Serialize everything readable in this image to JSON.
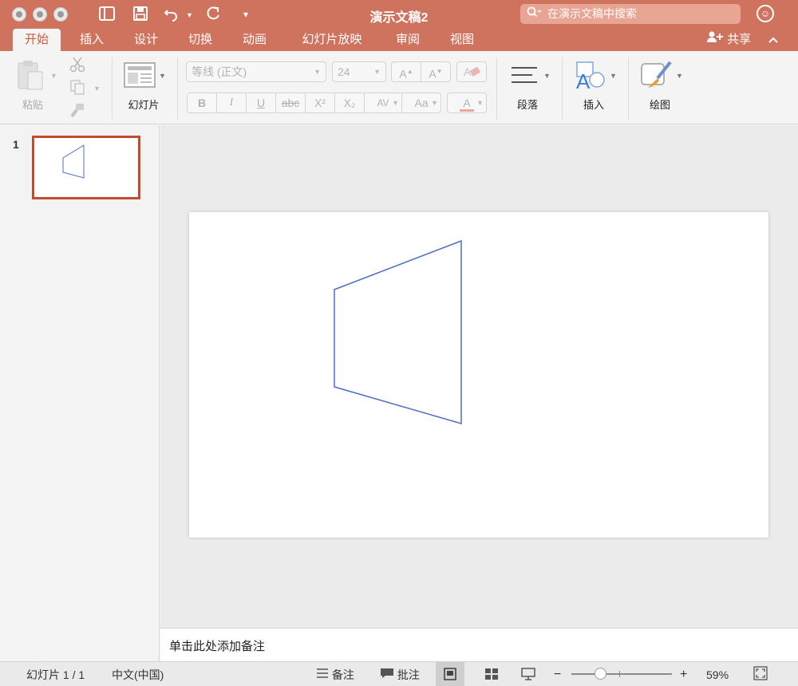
{
  "title_bar": {
    "doc_title": "演示文稿2",
    "search_placeholder": "在演示文稿中搜索",
    "icons": [
      "close-dot",
      "minimize-dot",
      "zoom-dot",
      "sidebar-icon",
      "save-icon",
      "undo-icon",
      "redo-icon",
      "customize-icon",
      "search-icon",
      "smiley-icon"
    ]
  },
  "tabs": [
    {
      "label": "开始",
      "active": true
    },
    {
      "label": "插入"
    },
    {
      "label": "设计"
    },
    {
      "label": "切换"
    },
    {
      "label": "动画"
    },
    {
      "label": "幻灯片放映"
    },
    {
      "label": "审阅"
    },
    {
      "label": "视图"
    }
  ],
  "share_label": "共享",
  "ribbon": {
    "paste_label": "粘贴",
    "slide_label": "幻灯片",
    "font_name": "等线 (正文)",
    "font_size": "24",
    "bold": "B",
    "italic": "I",
    "underline": "U",
    "strike": "abc",
    "superscript": "X²",
    "subscript": "X₂",
    "spacing": "AV",
    "case": "Aa",
    "font_color": "A",
    "grow": "A",
    "shrink": "A",
    "paragraph_label": "段落",
    "insert_label": "插入",
    "draw_label": "绘图"
  },
  "thumbnails": [
    {
      "number": "1",
      "selected": true
    }
  ],
  "notes_placeholder": "单击此处添加备注",
  "status": {
    "slide_count": "幻灯片 1 / 1",
    "language": "中文(中国)",
    "notes_label": "备注",
    "comments_label": "批注",
    "zoom_minus": "−",
    "zoom_plus": "+",
    "zoom_level": "59%",
    "zoom_fraction": 0.59
  },
  "colors": {
    "accent": "#d0735e",
    "shape_stroke": "#4a6fc7",
    "thumb_border": "#c44a2d"
  }
}
